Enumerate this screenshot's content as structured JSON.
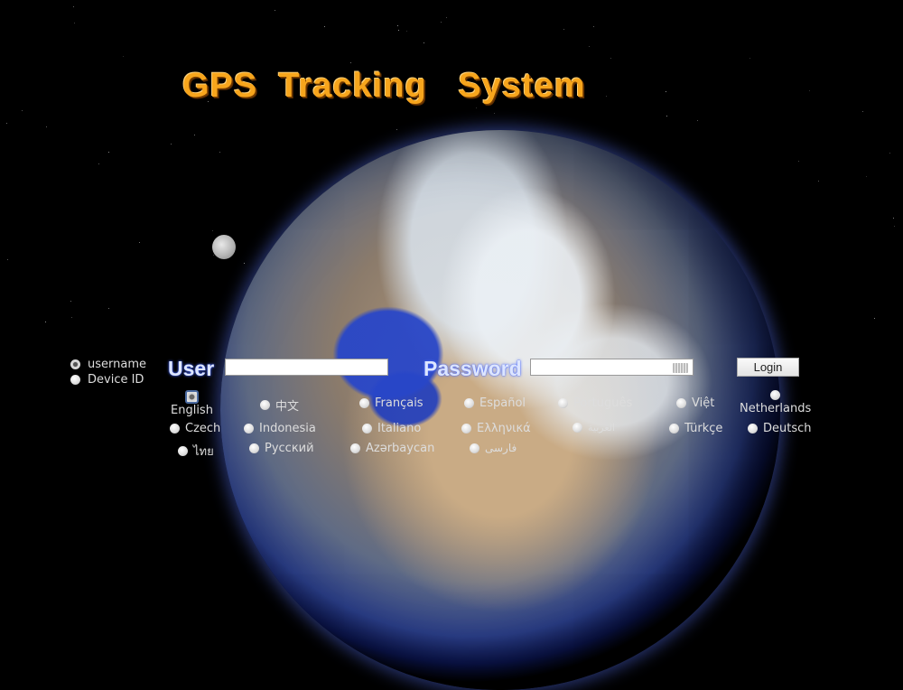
{
  "title": "GPS  Tracking   System",
  "login_type": {
    "options": [
      {
        "label": "username",
        "selected": true
      },
      {
        "label": "Device ID",
        "selected": false
      }
    ]
  },
  "form": {
    "user_label": "User",
    "user_value": "",
    "password_label": "Password",
    "password_value": "",
    "keyboard_icon": "keyboard-icon",
    "login_button": "Login"
  },
  "languages": [
    {
      "label": "English",
      "selected": true
    },
    {
      "label": "中文",
      "selected": false
    },
    {
      "label": "Français",
      "selected": false
    },
    {
      "label": "Español",
      "selected": false
    },
    {
      "label": "Português",
      "selected": false
    },
    {
      "label": "Việt",
      "selected": false
    },
    {
      "label": "Netherlands",
      "selected": false
    },
    {
      "label": "Czech",
      "selected": false
    },
    {
      "label": "Indonesia",
      "selected": false
    },
    {
      "label": "Italiano",
      "selected": false
    },
    {
      "label": "Ελληνικά",
      "selected": false
    },
    {
      "label": "العربية",
      "selected": false
    },
    {
      "label": "Türkçe",
      "selected": false
    },
    {
      "label": "Deutsch",
      "selected": false
    },
    {
      "label": "ไทย",
      "selected": false
    },
    {
      "label": "Русский",
      "selected": false
    },
    {
      "label": "Azərbaycan",
      "selected": false
    },
    {
      "label": "فارسی",
      "selected": false
    }
  ],
  "colors": {
    "title": "#f7a51c",
    "label_glow": "#4a6cff",
    "background": "#000000"
  }
}
